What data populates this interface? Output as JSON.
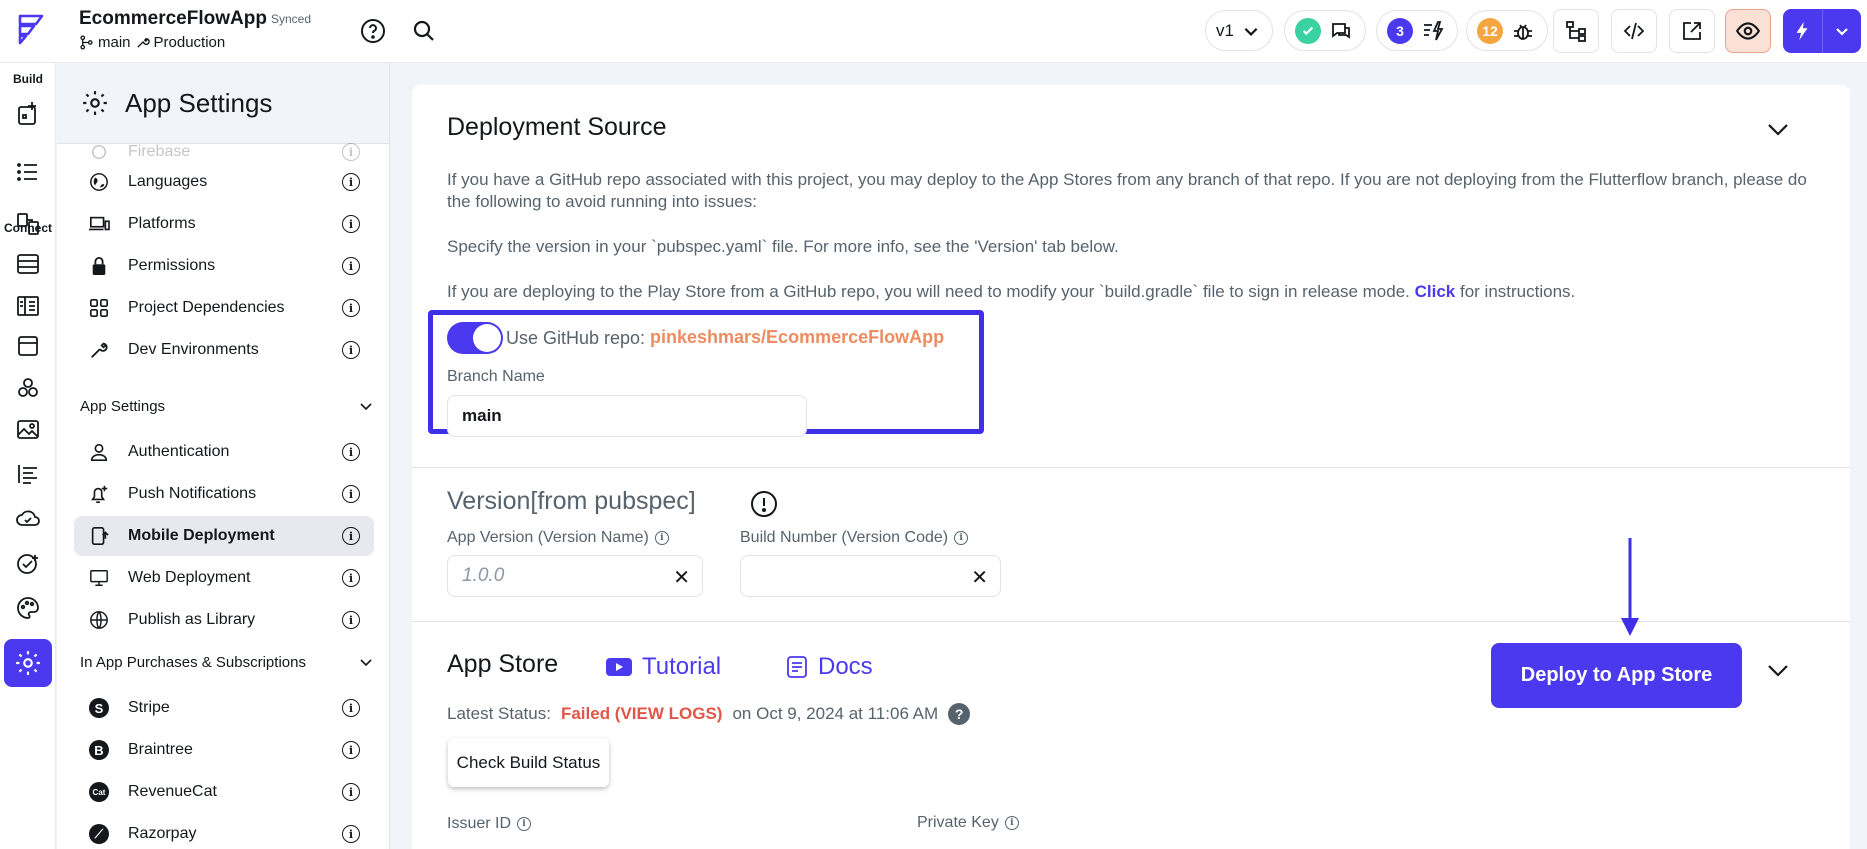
{
  "header": {
    "app_title": "EcommerceFlowApp",
    "sync_status": "Synced",
    "branch": "main",
    "environment": "Production",
    "version_label": "v1",
    "collab_count": "3",
    "issues_count": "12"
  },
  "rail": {
    "build_label": "Build",
    "connect_label": "Connect"
  },
  "panel": {
    "title": "App Settings",
    "items_top": [
      {
        "label": "Firebase",
        "icon": "firebase-icon"
      },
      {
        "label": "Languages",
        "icon": "globe-icon"
      },
      {
        "label": "Platforms",
        "icon": "devices-icon"
      },
      {
        "label": "Permissions",
        "icon": "lock-icon"
      },
      {
        "label": "Project Dependencies",
        "icon": "grid-icon"
      },
      {
        "label": "Dev Environments",
        "icon": "wrench-icon"
      }
    ],
    "section_app_settings": "App Settings",
    "items_app": [
      {
        "label": "Authentication",
        "icon": "person-icon"
      },
      {
        "label": "Push Notifications",
        "icon": "bell-plus-icon"
      },
      {
        "label": "Mobile Deployment",
        "icon": "mobile-upload-icon"
      },
      {
        "label": "Web Deployment",
        "icon": "monitor-icon"
      },
      {
        "label": "Publish as Library",
        "icon": "globe-icon"
      }
    ],
    "section_purchases": "In App Purchases & Subscriptions",
    "items_purchases": [
      {
        "label": "Stripe",
        "icon": "stripe-icon"
      },
      {
        "label": "Braintree",
        "icon": "braintree-icon"
      },
      {
        "label": "RevenueCat",
        "icon": "revenuecat-icon"
      },
      {
        "label": "Razorpay",
        "icon": "razorpay-icon"
      }
    ]
  },
  "deployment": {
    "title": "Deployment Source",
    "para1": "If you have a GitHub repo associated with this project, you may deploy to the App Stores from any branch of that repo. If you are not deploying from the Flutterflow branch, please do the following to avoid running into issues:",
    "para2": "Specify the version in your `pubspec.yaml` file. For more info, see the 'Version' tab below.",
    "para3_before": "If you are deploying to the Play Store from a GitHub repo, you will need to modify your `build.gradle` file to sign in release mode.",
    "para3_link": "Click",
    "para3_after": "for instructions.",
    "toggle_label": "Use GitHub repo:",
    "repo_name": "pinkeshmars/EcommerceFlowApp",
    "toggle_on": true,
    "branch_label": "Branch Name",
    "branch_value": "main"
  },
  "version": {
    "title": "Version[from pubspec]",
    "app_version_label": "App Version (Version Name)",
    "app_version_placeholder": "1.0.0",
    "build_number_label": "Build Number (Version Code)",
    "build_number_value": ""
  },
  "app_store": {
    "title": "App Store",
    "tutorial_label": "Tutorial",
    "docs_label": "Docs",
    "deploy_button": "Deploy to App Store",
    "status_label": "Latest Status:",
    "status_value": "Failed (VIEW LOGS)",
    "status_date": "on Oct 9, 2024 at 11:06 AM",
    "check_button": "Check Build Status",
    "issuer_label": "Issuer ID",
    "private_key_label": "Private Key"
  },
  "colors": {
    "accent": "#4b39ef",
    "repo": "#ee8b60",
    "failed": "#e0574a"
  }
}
